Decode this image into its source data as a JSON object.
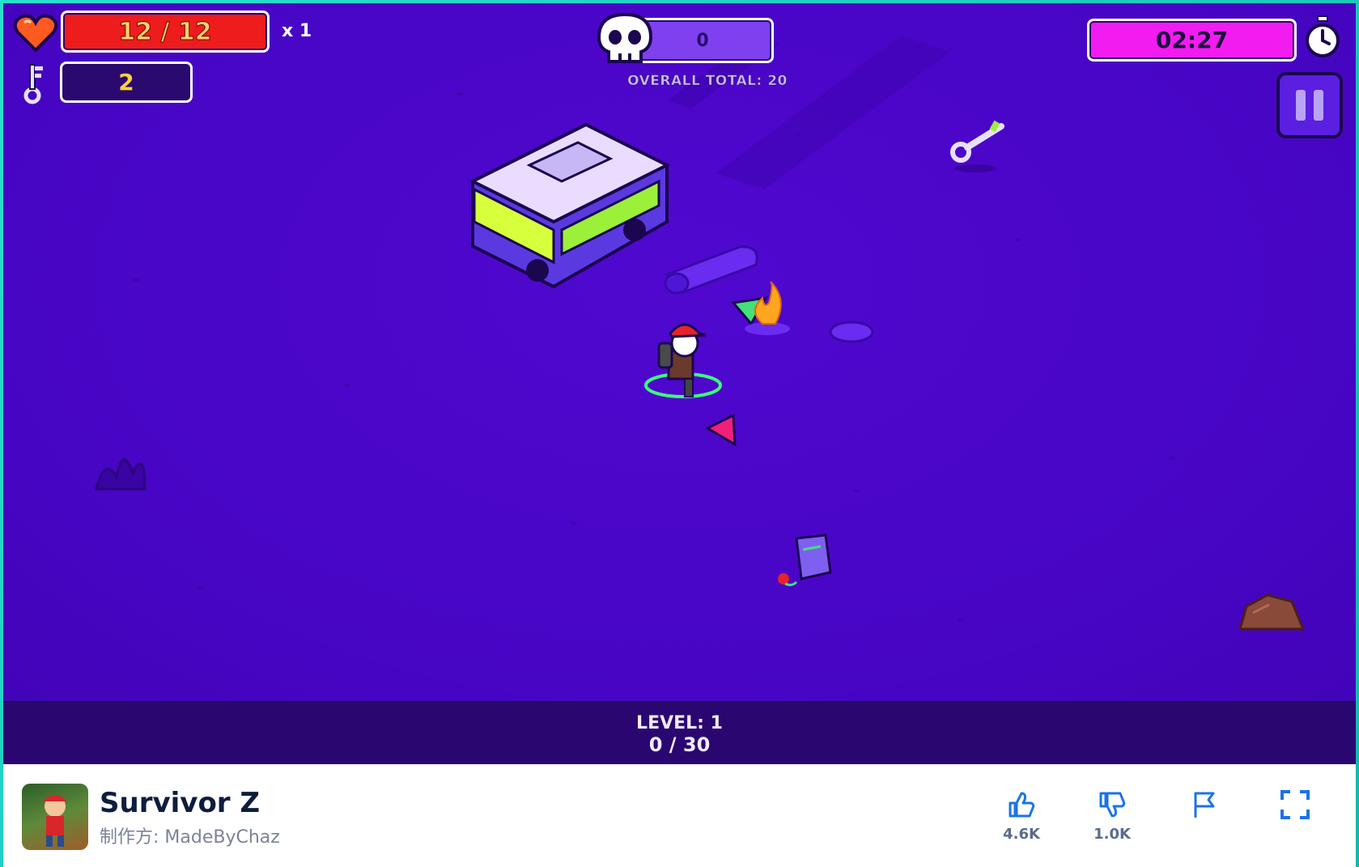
{
  "hud": {
    "health_text": "12 / 12",
    "multiplier": "x 1",
    "keys": "2",
    "kills": "0",
    "overall_total": "OVERALL TOTAL: 20",
    "timer": "02:27"
  },
  "level": {
    "label": "LEVEL: 1",
    "progress": "0 / 30"
  },
  "game_info": {
    "title": "Survivor Z",
    "author": "制作方: MadeByChaz",
    "likes": "4.6K",
    "dislikes": "1.0K"
  },
  "colors": {
    "ground": "#4a06c9",
    "health": "#ee1c1c",
    "timer": "#f21cf0",
    "accent": "#1a73e8"
  },
  "icons": [
    "heart-icon",
    "key-icon",
    "skull-icon",
    "stopwatch-icon",
    "pause-icon",
    "thumbs-up-icon",
    "thumbs-down-icon",
    "flag-icon",
    "fullscreen-icon"
  ]
}
